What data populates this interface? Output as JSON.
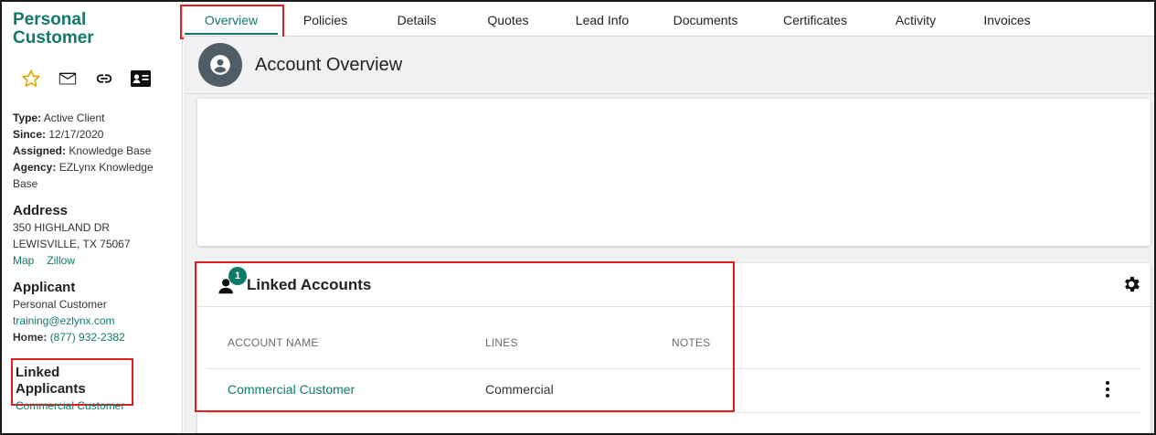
{
  "customer": {
    "name": "Personal Customer",
    "type_label": "Type:",
    "type_value": "Active Client",
    "since_label": "Since:",
    "since_value": "12/17/2020",
    "assigned_label": "Assigned:",
    "assigned_value": "Knowledge Base",
    "agency_label": "Agency:",
    "agency_value": "EZLynx Knowledge Base"
  },
  "actions": [
    "star-icon",
    "mail-icon",
    "link-icon",
    "contact-card-icon"
  ],
  "address": {
    "heading": "Address",
    "line1": "350 HIGHLAND DR",
    "line2": "LEWISVILLE, TX 75067",
    "map_link": "Map",
    "zillow_link": "Zillow"
  },
  "applicant": {
    "heading": "Applicant",
    "name": "Personal Customer",
    "email": "training@ezlynx.com",
    "home_label": "Home:",
    "home_phone": "(877) 932-2382"
  },
  "linked_applicants": {
    "heading": "Linked Applicants",
    "item": "Commercial Customer"
  },
  "tabs": [
    {
      "label": "Overview",
      "active": true
    },
    {
      "label": "Policies"
    },
    {
      "label": "Details"
    },
    {
      "label": "Quotes"
    },
    {
      "label": "Lead Info"
    },
    {
      "label": "Documents"
    },
    {
      "label": "Certificates"
    },
    {
      "label": "Activity"
    },
    {
      "label": "Invoices"
    }
  ],
  "overview": {
    "title": "Account Overview"
  },
  "linked_accounts": {
    "title": "Linked Accounts",
    "badge_count": "1",
    "columns": [
      "ACCOUNT NAME",
      "LINES",
      "NOTES"
    ],
    "rows": [
      {
        "account_name": "Commercial Customer",
        "lines": "Commercial",
        "notes": ""
      }
    ]
  },
  "colors": {
    "accent": "#0f7a6a",
    "highlight": "#e02020",
    "header_circle": "#4f5d66"
  }
}
